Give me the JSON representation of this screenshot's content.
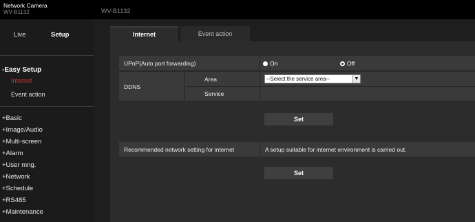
{
  "header": {
    "brand_title": "Network Camera",
    "brand_model": "WV-B1132",
    "model": "WV-B1132"
  },
  "mode_tabs": {
    "live": "Live",
    "setup": "Setup"
  },
  "easy_setup": {
    "title": "-Easy Setup",
    "items": [
      "Internet",
      "Event action"
    ]
  },
  "menu": [
    "+Basic",
    "+Image/Audio",
    "+Multi-screen",
    "+Alarm",
    "+User mng.",
    "+Network",
    "+Schedule",
    "+RS485",
    "+Maintenance"
  ],
  "content_tabs": [
    "Internet",
    "Event action"
  ],
  "form": {
    "upnp_label": "UPnP(Auto port forwarding)",
    "on_label": "On",
    "off_label": "Off",
    "upnp_value": "On",
    "ddns_label": "DDNS",
    "area_label": "Area",
    "area_value": "--Select the service area--",
    "service_label": "Service",
    "set_label": "Set",
    "recommended_label": "Recommended network setting for internet",
    "recommended_desc": "A setup suitable for internet environment is carried out.",
    "set2_label": "Set"
  },
  "colors": {
    "accent": "#c23838",
    "background": "#1e1e1e",
    "panel": "#2c2c2c"
  }
}
